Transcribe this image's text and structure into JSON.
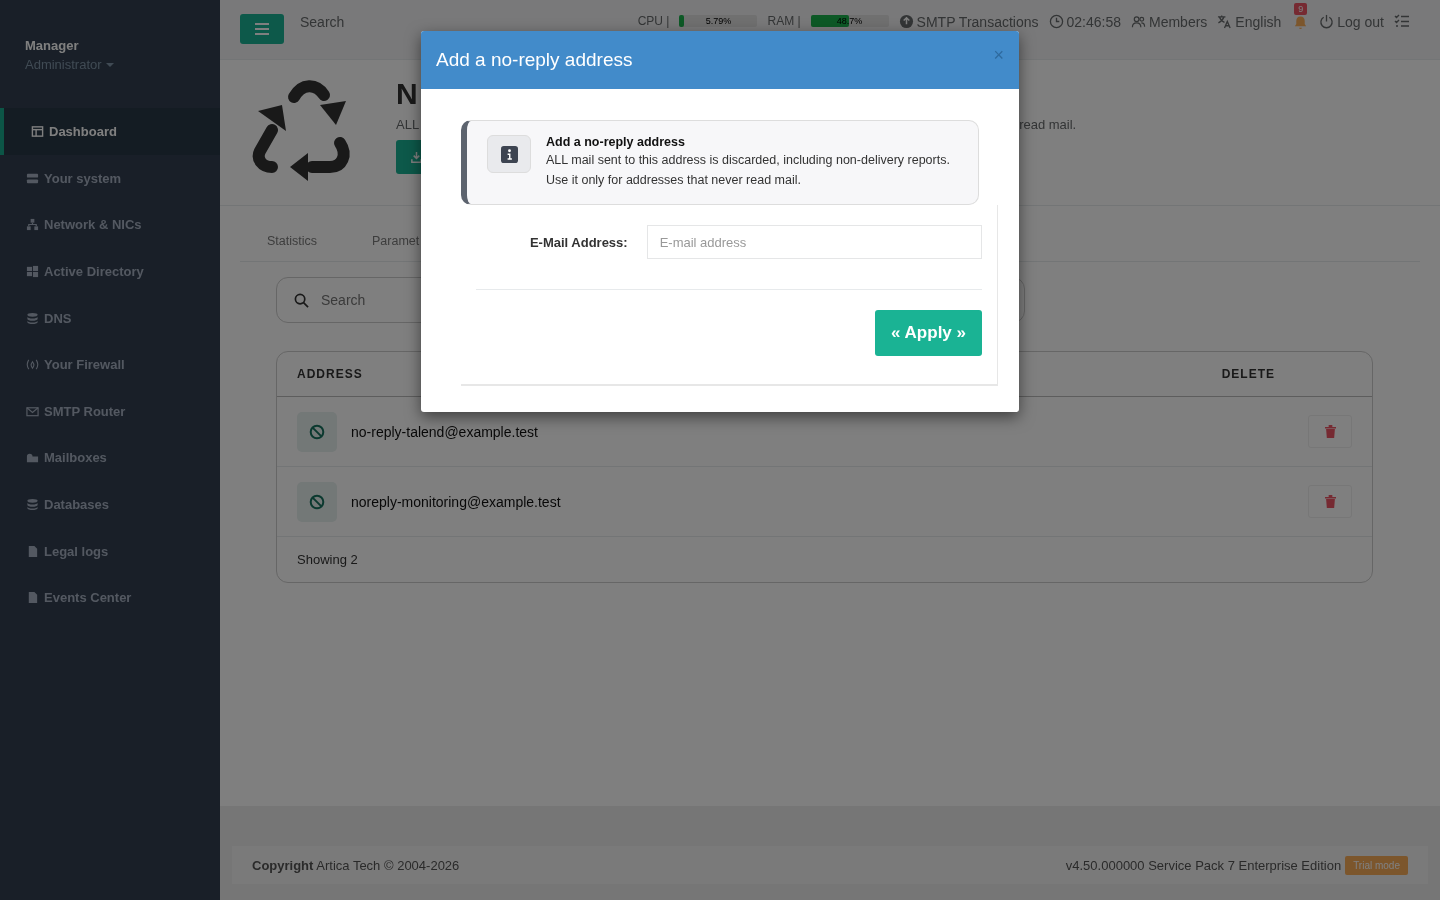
{
  "sidebar": {
    "user": {
      "name": "Manager",
      "role": "Administrator"
    },
    "items": [
      {
        "label": "Dashboard",
        "selected": true
      },
      {
        "label": "Your system",
        "selected": false
      },
      {
        "label": "Network & NICs",
        "selected": false
      },
      {
        "label": "Active Directory",
        "selected": false
      },
      {
        "label": "DNS",
        "selected": false
      },
      {
        "label": "Your Firewall",
        "selected": false
      },
      {
        "label": "SMTP Router",
        "selected": false
      },
      {
        "label": "Mailboxes",
        "selected": false
      },
      {
        "label": "Databases",
        "selected": false
      },
      {
        "label": "Legal logs",
        "selected": false
      },
      {
        "label": "Events Center",
        "selected": false
      }
    ]
  },
  "topbar": {
    "search": {
      "placeholder": "Search"
    },
    "meters": [
      {
        "label": "CPU |",
        "level": 0.0579,
        "reading": "5.79%"
      },
      {
        "label": "RAM |",
        "level": 0.487,
        "reading": "48.7%"
      }
    ],
    "links": [
      {
        "label": "SMTP Transactions"
      },
      {
        "label": "02:46:58"
      },
      {
        "label": "Members"
      },
      {
        "label": "English"
      }
    ],
    "notifications": {
      "count": "9"
    },
    "logout": "Log out"
  },
  "header": {
    "title": "N",
    "description_start": "ALL",
    "description_end": "read mail."
  },
  "tabs": [
    {
      "label": "Statistics"
    },
    {
      "label": "Paramet"
    }
  ],
  "list": {
    "search": {
      "placeholder": "Search"
    },
    "columns": [
      "ADDRESS",
      "DELETE"
    ],
    "rows": [
      {
        "address": "no-reply-talend@example.test"
      },
      {
        "address": "noreply-monitoring@example.test"
      }
    ],
    "footer": "Showing 2"
  },
  "footer": {
    "copyright": "**Copyright** Artica Tech © 2004-2026",
    "version": "v4.50.000000 Service Pack 7 Enterprise Edition",
    "badge": "Trial mode"
  },
  "modal": {
    "title": "Add a no-reply address",
    "close": "×",
    "info": {
      "title": "Add a no-reply address",
      "text": "ALL mail sent to this address is discarded, including non-delivery reports. Use it only for addresses that never read mail."
    },
    "form": {
      "label": "E-Mail Address:",
      "placeholder": "E-mail address"
    },
    "apply": "« Apply »"
  }
}
